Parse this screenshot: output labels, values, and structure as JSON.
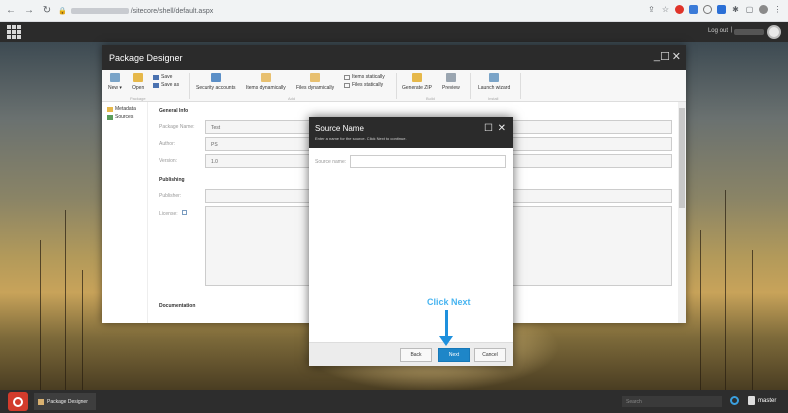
{
  "browser": {
    "url_text": "/sitecore/shell/default.aspx"
  },
  "topbar": {
    "logout": "Log out",
    "separator": "|"
  },
  "window": {
    "title": "Package Designer",
    "minimize": "_",
    "maximize": "☐",
    "close": "✕"
  },
  "ribbon": {
    "new": "New",
    "open": "Open",
    "save": "Save",
    "save_as": "Save as",
    "security_accounts": "Security accounts",
    "items_dynamically": "Items dynamically",
    "files_dynamically": "Files dynamically",
    "items_statically": "Items statically",
    "files_statically": "Files statically",
    "generate_zip": "Generate ZIP",
    "preview": "Preview",
    "launch_wizard": "Launch wizard",
    "group_package": "Package",
    "group_add": "Add",
    "group_build": "Build",
    "group_install": "Install"
  },
  "sidebar": {
    "items": [
      {
        "label": "Metadata"
      },
      {
        "label": "Sources"
      }
    ]
  },
  "form": {
    "general_info": "General Info",
    "package_name_label": "Package Name:",
    "package_name_value": "Test",
    "author_label": "Author:",
    "author_value": "PS",
    "version_label": "Version:",
    "version_value": "1.0",
    "publishing": "Publishing",
    "publisher_label": "Publisher:",
    "license_label": "License:",
    "documentation": "Documentation"
  },
  "dialog": {
    "title": "Source Name",
    "subtitle": "Enter a name for the source. Click Next to continue.",
    "maximize": "☐",
    "close": "✕",
    "field_label": "Source name:",
    "field_value": "",
    "back": "Back",
    "next": "Next",
    "cancel": "Cancel"
  },
  "annotation": {
    "text": "Click Next"
  },
  "taskbar": {
    "task_label": "Package Designer",
    "search_placeholder": "Search",
    "database": "master"
  }
}
